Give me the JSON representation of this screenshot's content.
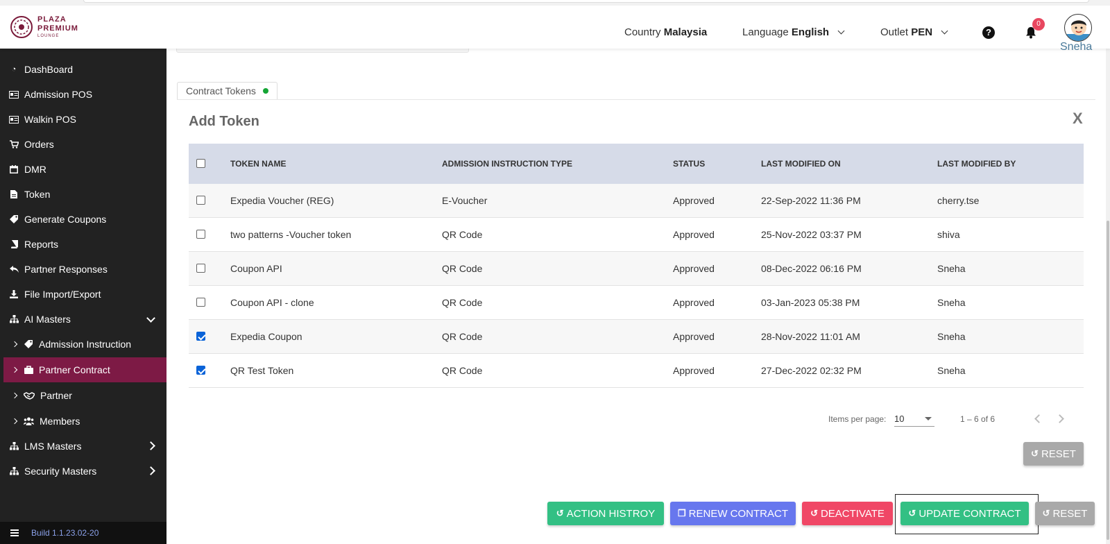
{
  "brand": {
    "line1": "PLAZA",
    "line2": "PREMIUM",
    "line3": "LOUNGE",
    "color": "#7a1a3a"
  },
  "header": {
    "country_label": "Country",
    "country_value": "Malaysia",
    "language_label": "Language",
    "language_value": "English",
    "outlet_label": "Outlet",
    "outlet_value": "PEN",
    "notification_count": "0",
    "user_name": "Sneha",
    "icons": [
      "help-icon",
      "bell-icon",
      "avatar"
    ]
  },
  "sidebar": {
    "items": [
      {
        "label": "DashBoard",
        "icon": "dashboard-icon"
      },
      {
        "label": "Admission POS",
        "icon": "id-card-icon"
      },
      {
        "label": "Walkin POS",
        "icon": "id-card-icon"
      },
      {
        "label": "Orders",
        "icon": "cart-icon"
      },
      {
        "label": "DMR",
        "icon": "calendar-icon"
      },
      {
        "label": "Token",
        "icon": "file-icon"
      },
      {
        "label": "Generate Coupons",
        "icon": "tag-icon"
      },
      {
        "label": "Reports",
        "icon": "book-icon"
      },
      {
        "label": "Partner Responses",
        "icon": "reply-icon"
      },
      {
        "label": "File Import/Export",
        "icon": "download-icon"
      },
      {
        "label": "AI Masters",
        "icon": "sitemap-icon"
      },
      {
        "label": "Admission Instruction",
        "icon": "tag-icon"
      },
      {
        "label": "Partner Contract",
        "icon": "briefcase-icon"
      },
      {
        "label": "Partner",
        "icon": "handshake-icon"
      },
      {
        "label": "Members",
        "icon": "users-icon"
      },
      {
        "label": "LMS Masters",
        "icon": "sitemap-icon"
      },
      {
        "label": "Security Masters",
        "icon": "sitemap-icon"
      }
    ],
    "active_item": "Partner Contract",
    "active_color": "#7d1a45",
    "build": "Build 1.1.23.02-20"
  },
  "tab": {
    "label": "Contract Tokens",
    "status_color": "#15a535"
  },
  "panel": {
    "title": "Add Token",
    "close_label": "X"
  },
  "table": {
    "columns": [
      "TOKEN NAME",
      "ADMISSION INSTRUCTION TYPE",
      "STATUS",
      "LAST MODIFIED ON",
      "LAST MODIFIED BY"
    ],
    "rows": [
      {
        "checked": false,
        "token_name": "Expedia Voucher (REG)",
        "type": "E-Voucher",
        "status": "Approved",
        "modified_on": "22-Sep-2022 11:36 PM",
        "modified_by": "cherry.tse"
      },
      {
        "checked": false,
        "token_name": "two patterns -Voucher token",
        "type": "QR Code",
        "status": "Approved",
        "modified_on": "25-Nov-2022 03:37 PM",
        "modified_by": "shiva"
      },
      {
        "checked": false,
        "token_name": "Coupon API",
        "type": "QR Code",
        "status": "Approved",
        "modified_on": "08-Dec-2022 06:16 PM",
        "modified_by": "Sneha"
      },
      {
        "checked": false,
        "token_name": "Coupon API - clone",
        "type": "QR Code",
        "status": "Approved",
        "modified_on": "03-Jan-2023 05:38 PM",
        "modified_by": "Sneha"
      },
      {
        "checked": true,
        "token_name": "Expedia Coupon",
        "type": "QR Code",
        "status": "Approved",
        "modified_on": "28-Nov-2022 11:01 AM",
        "modified_by": "Sneha"
      },
      {
        "checked": true,
        "token_name": "QR Test Token",
        "type": "QR Code",
        "status": "Approved",
        "modified_on": "27-Dec-2022 02:32 PM",
        "modified_by": "Sneha"
      }
    ]
  },
  "paginator": {
    "items_per_page_label": "Items per page:",
    "items_per_page": "10",
    "range": "1 – 6 of 6"
  },
  "buttons": {
    "reset_inner": "RESET",
    "action_history": "ACTION HISTROY",
    "renew_contract": "RENEW CONTRACT",
    "deactivate": "DEACTIVATE",
    "update_contract": "UPDATE CONTRACT",
    "reset": "RESET",
    "colors": {
      "green": "#33c084",
      "blue": "#6777ee",
      "red": "#f04766",
      "gray": "#a9a9a9"
    }
  }
}
